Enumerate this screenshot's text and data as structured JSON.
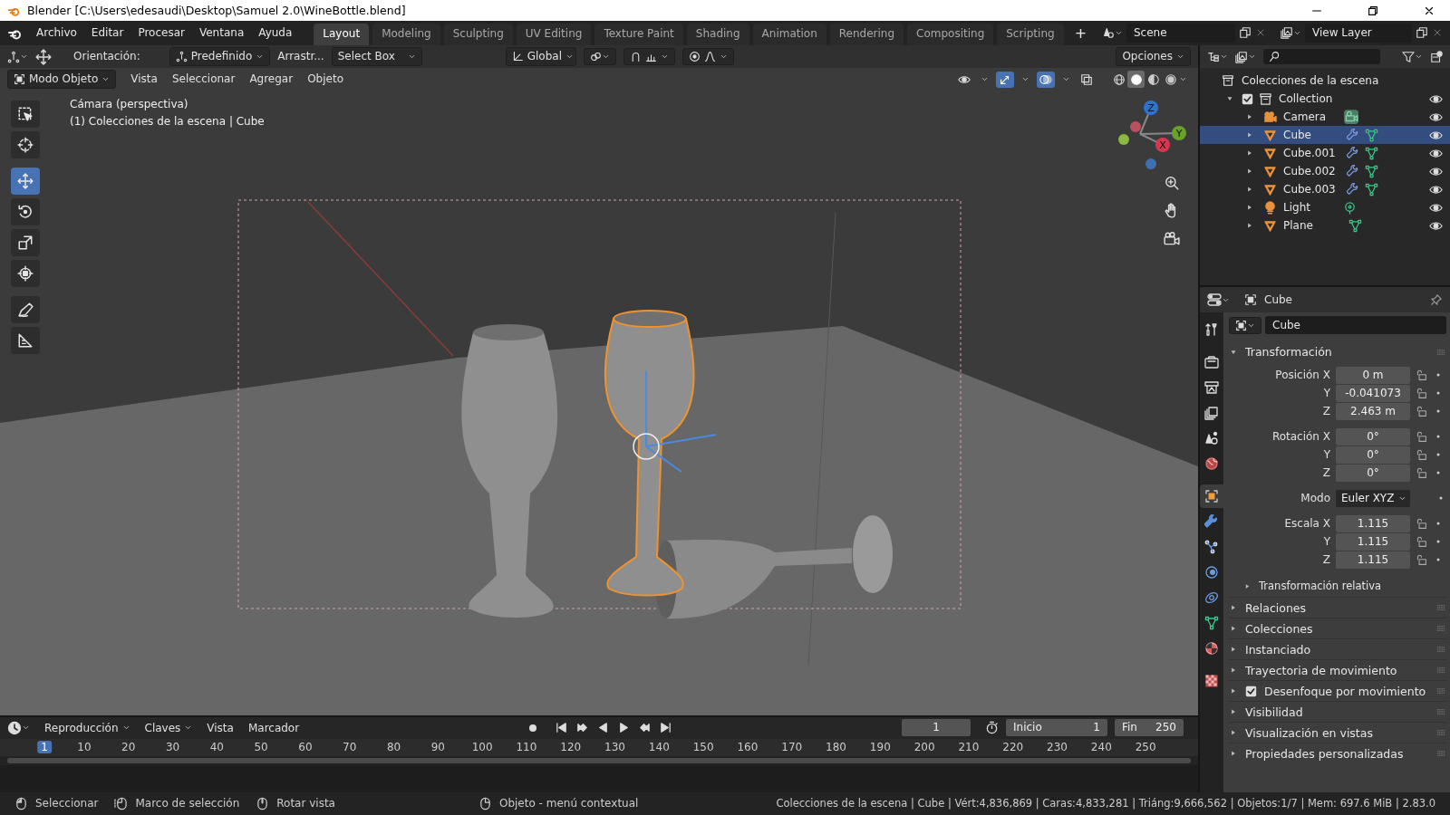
{
  "window": {
    "title": "Blender [C:\\Users\\edesaudi\\Desktop\\Samuel 2.0\\WineBottle.blend]"
  },
  "menu": [
    "Archivo",
    "Editar",
    "Procesar",
    "Ventana",
    "Ayuda"
  ],
  "workspaces": [
    {
      "label": "Layout",
      "selected": true
    },
    {
      "label": "Modeling",
      "selected": false
    },
    {
      "label": "Sculpting",
      "selected": false
    },
    {
      "label": "UV Editing",
      "selected": false
    },
    {
      "label": "Texture Paint",
      "selected": false
    },
    {
      "label": "Shading",
      "selected": false
    },
    {
      "label": "Animation",
      "selected": false
    },
    {
      "label": "Rendering",
      "selected": false
    },
    {
      "label": "Compositing",
      "selected": false
    },
    {
      "label": "Scripting",
      "selected": false
    }
  ],
  "add_workspace": "+",
  "scene": "Scene",
  "view_layer": "View Layer",
  "tool_header": {
    "orientation_label": "Orientación:",
    "pivot": "Predefinido",
    "drag_label": "Arrastr...",
    "drag": "Select Box",
    "transform": "Global",
    "options": "Opciones"
  },
  "viewport_header": {
    "mode": "Modo Objeto",
    "menu": [
      "Vista",
      "Seleccionar",
      "Agregar",
      "Objeto"
    ],
    "toggles": [
      {
        "kind": "visibility",
        "selected": false
      },
      {
        "kind": "gizmo",
        "selected": true
      },
      {
        "kind": "overlay",
        "selected": true
      },
      {
        "kind": "xray",
        "selected": false
      }
    ],
    "shading": [
      {
        "kind": "wireframe",
        "selected": false
      },
      {
        "kind": "solid",
        "selected": true
      },
      {
        "kind": "material",
        "selected": false
      },
      {
        "kind": "rendered",
        "selected": false
      }
    ]
  },
  "tools": [
    {
      "kind": "select",
      "selected": false
    },
    {
      "kind": "cursor",
      "selected": false
    },
    {
      "kind": "move",
      "selected": true
    },
    {
      "kind": "rotate",
      "selected": false
    },
    {
      "kind": "scale",
      "selected": false
    },
    {
      "kind": "transform",
      "selected": false
    },
    {
      "kind": "annotate",
      "selected": false
    },
    {
      "kind": "measure",
      "selected": false
    }
  ],
  "viewport": {
    "camera_label": "Cámara (perspectiva)",
    "context": "(1) Colecciones de la escena | Cube",
    "gizmo_axes": [
      "Z",
      "Y",
      "X"
    ]
  },
  "outliner": {
    "root": "Colecciones de la escena",
    "tree": [
      {
        "label": "Collection",
        "kind": "collection",
        "checked": true,
        "expanded": true,
        "visible": true,
        "selected": false,
        "children": [
          {
            "label": "Camera",
            "kind": "camera",
            "expanded": false,
            "visible": true,
            "selected": false,
            "has_modifier": false
          },
          {
            "label": "Cube",
            "kind": "mesh",
            "expanded": false,
            "visible": true,
            "selected": true,
            "has_modifier": true
          },
          {
            "label": "Cube.001",
            "kind": "mesh",
            "expanded": false,
            "visible": true,
            "selected": false,
            "has_modifier": true
          },
          {
            "label": "Cube.002",
            "kind": "mesh",
            "expanded": false,
            "visible": true,
            "selected": false,
            "has_modifier": true
          },
          {
            "label": "Cube.003",
            "kind": "mesh",
            "expanded": false,
            "visible": true,
            "selected": false,
            "has_modifier": true
          },
          {
            "label": "Light",
            "kind": "light",
            "expanded": false,
            "visible": true,
            "selected": false,
            "has_modifier": false
          },
          {
            "label": "Plane",
            "kind": "plane",
            "expanded": false,
            "visible": true,
            "selected": false,
            "has_modifier": false
          }
        ]
      }
    ]
  },
  "properties": {
    "object_name": "Cube",
    "data_name": "Cube",
    "tabs": [
      {
        "kind": "tool",
        "selected": false
      },
      {
        "kind": "render",
        "selected": false
      },
      {
        "kind": "output",
        "selected": false
      },
      {
        "kind": "view_layer",
        "selected": false
      },
      {
        "kind": "scene",
        "selected": false
      },
      {
        "kind": "world",
        "selected": false
      },
      {
        "kind": "object",
        "selected": true
      },
      {
        "kind": "modifier",
        "selected": false
      },
      {
        "kind": "particles",
        "selected": false
      },
      {
        "kind": "physics",
        "selected": false
      },
      {
        "kind": "constraints",
        "selected": false
      },
      {
        "kind": "data",
        "selected": false
      },
      {
        "kind": "material",
        "selected": false
      },
      {
        "kind": "texture",
        "selected": false
      }
    ],
    "transform": {
      "title": "Transformación",
      "expanded": true,
      "groups": [
        [
          {
            "label": "Posición X",
            "value": "0 m",
            "kind": "number"
          },
          {
            "label": "Y",
            "value": "-0.041073",
            "kind": "number"
          },
          {
            "label": "Z",
            "value": "2.463 m",
            "kind": "number"
          }
        ],
        [
          {
            "label": "Rotación X",
            "value": "0°",
            "kind": "number"
          },
          {
            "label": "Y",
            "value": "0°",
            "kind": "number"
          },
          {
            "label": "Z",
            "value": "0°",
            "kind": "number"
          }
        ],
        [
          {
            "label": "Modo",
            "value": "Euler XYZ",
            "kind": "dropdown"
          }
        ],
        [
          {
            "label": "Escala X",
            "value": "1.115",
            "kind": "number"
          },
          {
            "label": "Y",
            "value": "1.115",
            "kind": "number"
          },
          {
            "label": "Z",
            "value": "1.115",
            "kind": "number"
          }
        ]
      ],
      "subpanel": {
        "title": "Transformación relativa",
        "expanded": false
      }
    },
    "panels": [
      {
        "title": "Relaciones",
        "kind": "plain",
        "expanded": false
      },
      {
        "title": "Colecciones",
        "kind": "plain",
        "expanded": false
      },
      {
        "title": "Instanciado",
        "kind": "plain",
        "expanded": false
      },
      {
        "title": "Trayectoria de movimiento",
        "kind": "plain",
        "expanded": false
      },
      {
        "title": "Desenfoque por movimiento",
        "kind": "checkbox",
        "checked": true,
        "expanded": false
      },
      {
        "title": "Visibilidad",
        "kind": "plain",
        "expanded": false
      },
      {
        "title": "Visualización en vistas",
        "kind": "plain",
        "expanded": false
      },
      {
        "title": "Propiedades personalizadas",
        "kind": "plain",
        "expanded": false
      }
    ]
  },
  "timeline": {
    "menu": [
      {
        "label": "Reproducción",
        "kind": "dropdown"
      },
      {
        "label": "Claves",
        "kind": "dropdown"
      },
      {
        "label": "Vista",
        "kind": "plain"
      },
      {
        "label": "Marcador",
        "kind": "plain"
      }
    ],
    "current_frame": "1",
    "start_label": "Inicio",
    "start": "1",
    "end_label": "Fin",
    "end": "250",
    "ruler": [
      {
        "label": "1",
        "selected": true
      },
      {
        "label": "10",
        "selected": false
      },
      {
        "label": "20",
        "selected": false
      },
      {
        "label": "30",
        "selected": false
      },
      {
        "label": "40",
        "selected": false
      },
      {
        "label": "50",
        "selected": false
      },
      {
        "label": "60",
        "selected": false
      },
      {
        "label": "70",
        "selected": false
      },
      {
        "label": "80",
        "selected": false
      },
      {
        "label": "90",
        "selected": false
      },
      {
        "label": "100",
        "selected": false
      },
      {
        "label": "110",
        "selected": false
      },
      {
        "label": "120",
        "selected": false
      },
      {
        "label": "130",
        "selected": false
      },
      {
        "label": "140",
        "selected": false
      },
      {
        "label": "150",
        "selected": false
      },
      {
        "label": "160",
        "selected": false
      },
      {
        "label": "170",
        "selected": false
      },
      {
        "label": "180",
        "selected": false
      },
      {
        "label": "190",
        "selected": false
      },
      {
        "label": "200",
        "selected": false
      },
      {
        "label": "210",
        "selected": false
      },
      {
        "label": "220",
        "selected": false
      },
      {
        "label": "230",
        "selected": false
      },
      {
        "label": "240",
        "selected": false
      },
      {
        "label": "250",
        "selected": false
      }
    ]
  },
  "status_bar": {
    "hints": [
      {
        "kind": "left",
        "label": "Seleccionar"
      },
      {
        "kind": "drag",
        "label": "Marco de selección"
      },
      {
        "kind": "middle",
        "label": "Rotar vista"
      },
      {
        "kind": "right",
        "label": "Objeto - menú contextual"
      }
    ],
    "stats": "Colecciones de la escena | Cube | Vért:4,836,869 | Caras:4,833,281 | Triáng:9,666,562 | Objetos:1/7 | Mem: 697.6 MiB | 2.83.0"
  }
}
